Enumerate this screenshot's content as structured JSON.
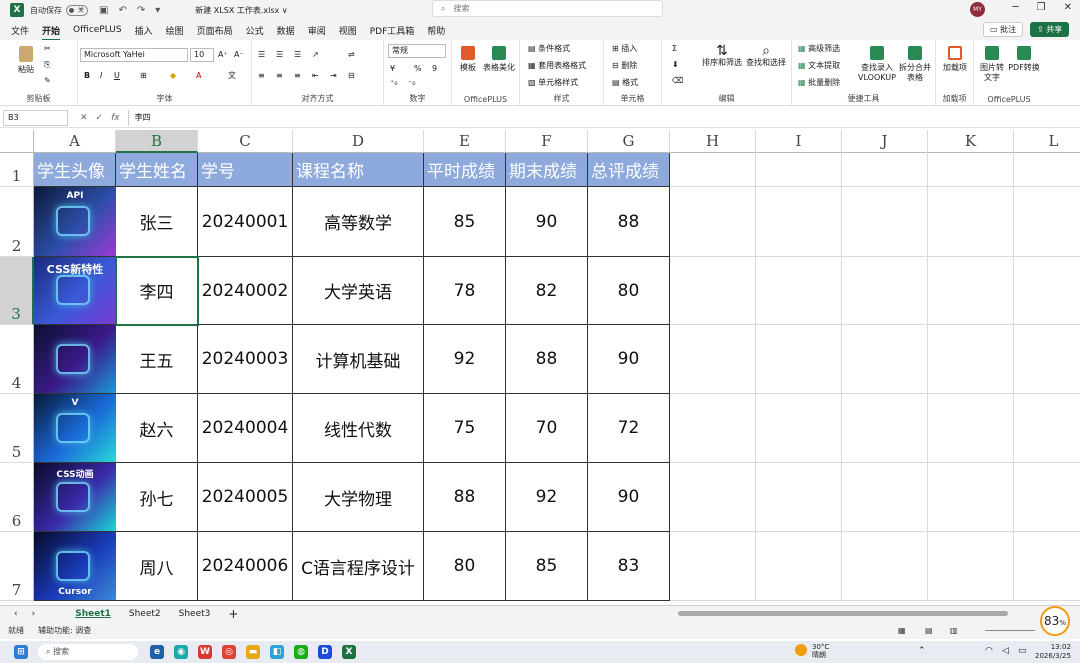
{
  "window": {
    "autosave_label": "自动保存",
    "autosave_state": "关",
    "filename": "新建 XLSX 工作表.xlsx ∨",
    "search_placeholder": "搜索",
    "user_initials": "MY"
  },
  "menu": {
    "items": [
      "文件",
      "开始",
      "OfficePLUS",
      "插入",
      "绘图",
      "页面布局",
      "公式",
      "数据",
      "审阅",
      "视图",
      "PDF工具箱",
      "帮助"
    ],
    "active": "开始",
    "comment_label": "批注",
    "share_label": "共享"
  },
  "ribbon": {
    "paste": "粘贴",
    "clipboard": "剪贴板",
    "font_name": "Microsoft YaHei",
    "font_size": "10",
    "font_group": "字体",
    "align_group": "对齐方式",
    "number_format": "常规",
    "number_group": "数字",
    "template": "模板",
    "table_beautify": "表格美化",
    "officeplus_group": "OfficePLUS",
    "cond_format": "条件格式",
    "table_format": "套用表格格式",
    "cell_style": "单元格样式",
    "style_group": "样式",
    "insert": "插入",
    "delete": "删除",
    "format": "格式",
    "cells_group": "单元格",
    "sort_filter": "排序和筛选",
    "find_select": "查找和选择",
    "edit_group": "编辑",
    "adv_filter": "高级筛选",
    "text_extract": "文本提取",
    "batch_delete": "批量删除",
    "vlookup": "查找录入 VLOOKUP",
    "split_merge": "拆分合并表格",
    "tools_group": "便捷工具",
    "addins": "加载项",
    "addins_group": "加载项",
    "img2text": "图片转文字",
    "pdf_convert": "PDF转换",
    "officeplus_group2": "OfficePLUS"
  },
  "formula_bar": {
    "cell_ref": "B3",
    "content": "李四"
  },
  "grid": {
    "columns": [
      "A",
      "B",
      "C",
      "D",
      "E",
      "F",
      "G",
      "H",
      "I",
      "J",
      "K",
      "L"
    ],
    "rows": [
      "1",
      "2",
      "3",
      "4",
      "5",
      "6",
      "7"
    ],
    "selected_col": "B",
    "selected_row": "3"
  },
  "table": {
    "headers": [
      "学生头像",
      "学生姓名",
      "学号",
      "课程名称",
      "平时成绩",
      "期末成绩",
      "总评成绩"
    ],
    "rows": [
      {
        "name": "张三",
        "id": "20240001",
        "course": "高等数学",
        "usual": "85",
        "final": "90",
        "total": "88",
        "thumb_text": "API"
      },
      {
        "name": "李四",
        "id": "20240002",
        "course": "大学英语",
        "usual": "78",
        "final": "82",
        "total": "80",
        "thumb_text": "CSS新特性"
      },
      {
        "name": "王五",
        "id": "20240003",
        "course": "计算机基础",
        "usual": "92",
        "final": "88",
        "total": "90",
        "thumb_text": ""
      },
      {
        "name": "赵六",
        "id": "20240004",
        "course": "线性代数",
        "usual": "75",
        "final": "70",
        "total": "72",
        "thumb_text": "V"
      },
      {
        "name": "孙七",
        "id": "20240005",
        "course": "大学物理",
        "usual": "88",
        "final": "92",
        "total": "90",
        "thumb_text": "CSS动画"
      },
      {
        "name": "周八",
        "id": "20240006",
        "course": "C语言程序设计",
        "usual": "80",
        "final": "85",
        "total": "83",
        "thumb_text": "Cursor"
      }
    ]
  },
  "sheets": [
    "Sheet1",
    "Sheet2",
    "Sheet3"
  ],
  "active_sheet": "Sheet1",
  "status": {
    "ready": "就绪",
    "accessibility": "辅助功能: 调查",
    "zoom": "83",
    "zoom_unit": "%"
  },
  "taskbar": {
    "search": "搜索",
    "weather_temp": "30°C",
    "weather_desc": "晴朗",
    "time": "13:02",
    "date": "2026/3/25"
  },
  "colors": {
    "header_fill": "#8ea9db",
    "excel_green": "#217346"
  }
}
